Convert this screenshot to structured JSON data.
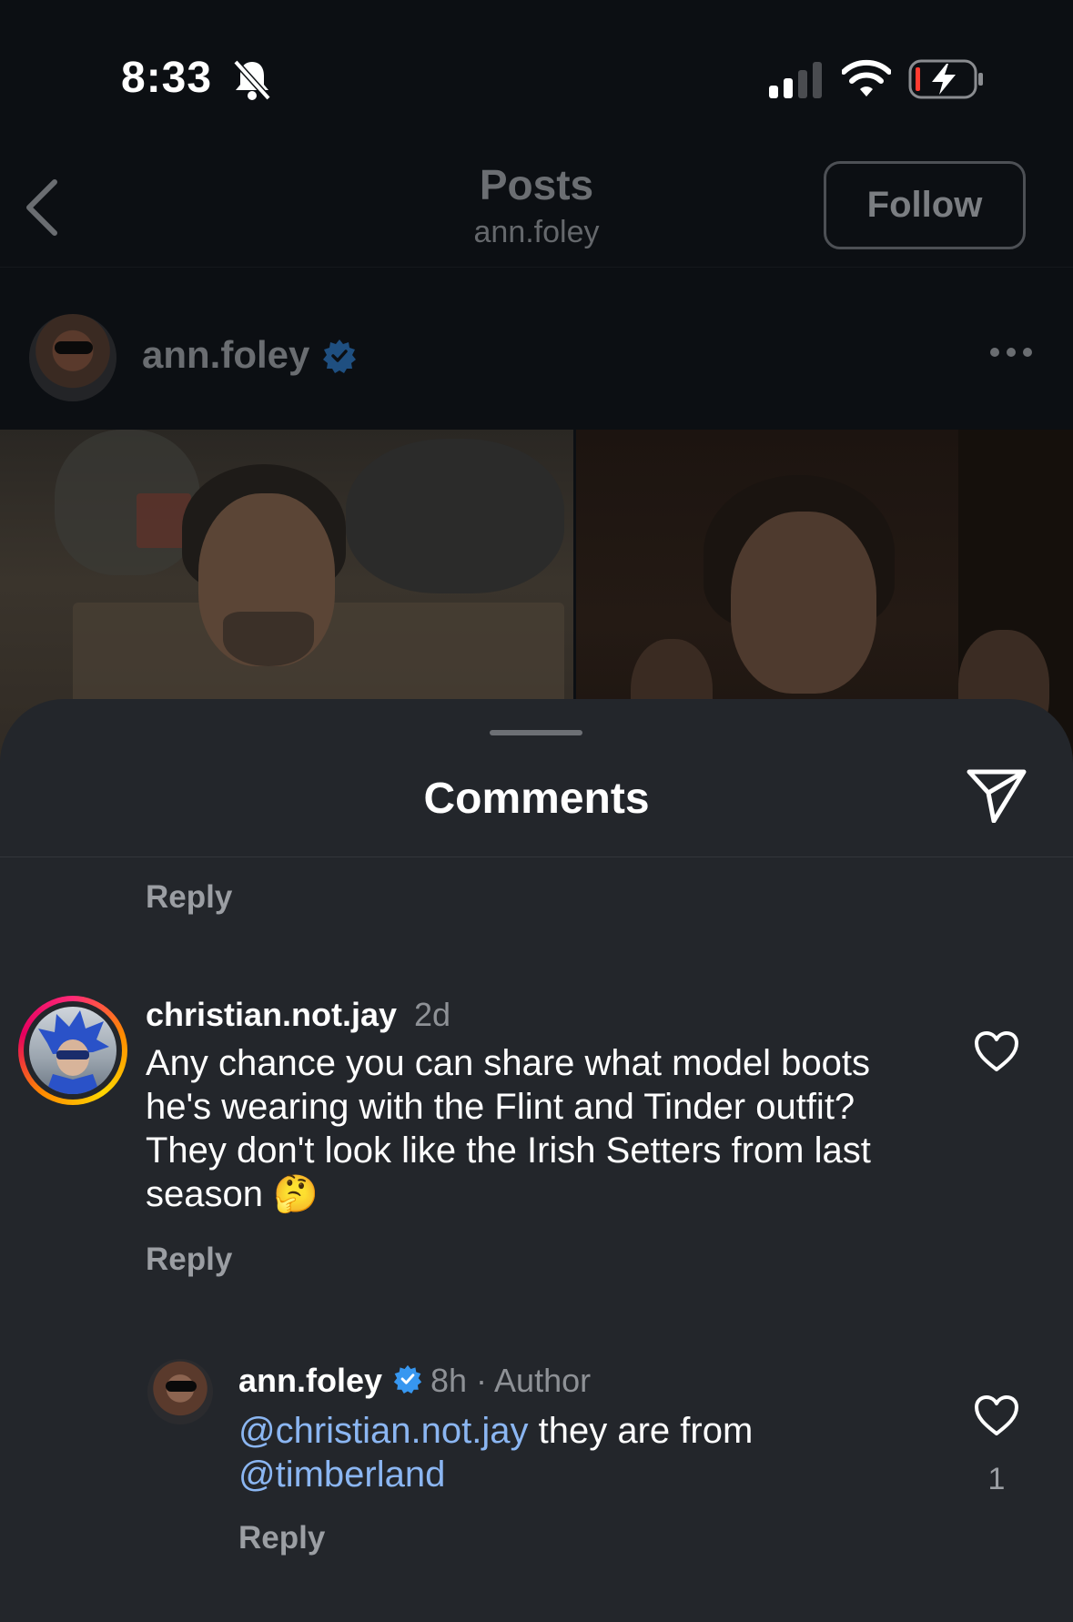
{
  "status_bar": {
    "time": "8:33"
  },
  "header": {
    "title": "Posts",
    "subtitle": "ann.foley",
    "follow_label": "Follow"
  },
  "post": {
    "username": "ann.foley"
  },
  "comments_sheet": {
    "title": "Comments",
    "reply_label": "Reply",
    "comment": {
      "username": "christian.not.jay",
      "time": "2d",
      "text": "Any chance you can share what model boots he's wearing with the Flint and Tinder outfit? They don't look like the Irish Setters from last season 🤔",
      "reply_label": "Reply"
    },
    "reply": {
      "username": "ann.foley",
      "meta": "8h · Author",
      "mention_1": "@christian.not.jay",
      "text_middle": " they are from ",
      "mention_2": "@timberland",
      "likes": "1",
      "reply_label": "Reply"
    }
  }
}
